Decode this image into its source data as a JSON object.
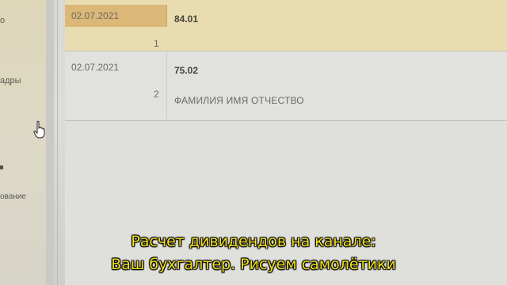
{
  "sidebar": {
    "items": [
      {
        "label": "о"
      },
      {
        "label": "адры"
      },
      {
        "label": "ование"
      }
    ]
  },
  "table": {
    "rows": [
      {
        "date": "02.07.2021",
        "amount": "84.01",
        "number": "1",
        "name": ""
      },
      {
        "date": "02.07.2021",
        "amount": "75.02",
        "number": "2",
        "name": "ФАМИЛИЯ ИМЯ ОТЧЕСТВО"
      }
    ]
  },
  "subtitles": {
    "line1": "Расчет дивидендов на канале:",
    "line2": "Ваш бухгалтер. Рисуем самолётики"
  },
  "colors": {
    "selected_row": "#e8dcb0",
    "selected_cell": "#dcb878",
    "subtitle_text": "#f0e020"
  }
}
